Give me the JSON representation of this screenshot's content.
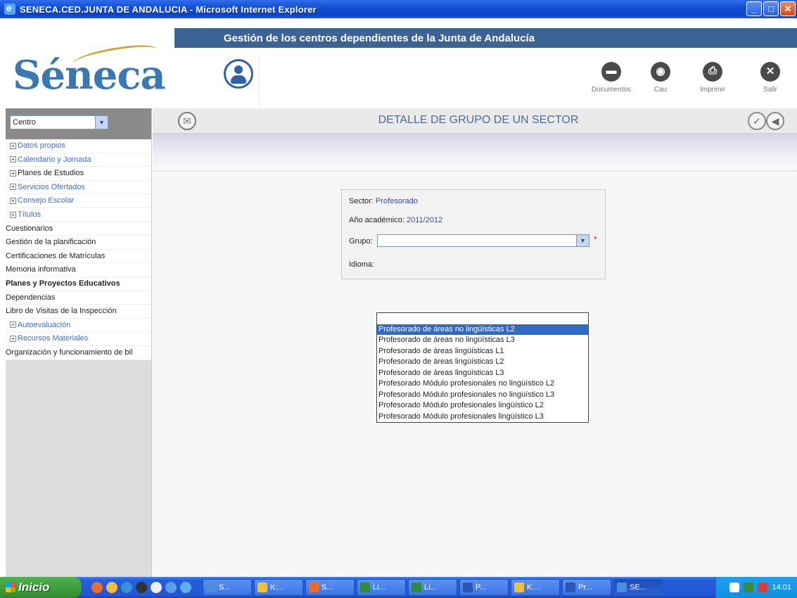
{
  "window": {
    "title": "SENECA.CED.JUNTA DE ANDALUCIA - Microsoft Internet Explorer",
    "minimize": "_",
    "maximize": "□",
    "close": "✕"
  },
  "header": {
    "banner": "Gestión de los centros dependientes de la Junta de Andalucía",
    "logo": "Séneca",
    "buttons": [
      {
        "label": "Documentos",
        "icon": "documents-icon",
        "glyph": "▬"
      },
      {
        "label": "Cau",
        "icon": "cau-icon",
        "glyph": "◉"
      },
      {
        "label": "Imprimir",
        "icon": "print-icon",
        "glyph": "⎙"
      },
      {
        "label": "Salir",
        "icon": "exit-icon",
        "glyph": "✕"
      }
    ]
  },
  "sidebar": {
    "centro_select": "Centro",
    "items": [
      {
        "label": "Datos propios",
        "expandable": true,
        "color": "blue"
      },
      {
        "label": "Calendario y Jornada",
        "expandable": true,
        "color": "blue"
      },
      {
        "label": "Planes de Estudios",
        "expandable": true,
        "color": "black"
      },
      {
        "label": "Servicios Ofertados",
        "expandable": true,
        "color": "blue"
      },
      {
        "label": "Consejo Escolar",
        "expandable": true,
        "color": "blue"
      },
      {
        "label": "Títulos",
        "expandable": true,
        "color": "blue"
      },
      {
        "label": "Cuestionarios",
        "expandable": false,
        "color": "black"
      },
      {
        "label": "Gestión de la planificación",
        "expandable": false,
        "color": "black"
      },
      {
        "label": "Certificaciones de Matrículas",
        "expandable": false,
        "color": "black"
      },
      {
        "label": "Memoria informativa",
        "expandable": false,
        "color": "black"
      },
      {
        "label": "Planes y Proyectos Educativos",
        "expandable": false,
        "color": "black",
        "bold": true
      },
      {
        "label": "Dependencias",
        "expandable": false,
        "color": "black"
      },
      {
        "label": "Libro de Visitas de la Inspección",
        "expandable": false,
        "color": "black"
      },
      {
        "label": "Autoevaluación",
        "expandable": true,
        "color": "blue"
      },
      {
        "label": "Recursos Materiales",
        "expandable": true,
        "color": "blue"
      },
      {
        "label": "Organización y funcionamiento de bil",
        "expandable": false,
        "color": "black"
      }
    ]
  },
  "main": {
    "title": "DETALLE DE GRUPO DE UN SECTOR",
    "form": {
      "sector_label": "Sector:",
      "sector_value": "Profesorado",
      "anio_label": "Año académico:",
      "anio_value": "2011/2012",
      "grupo_label": "Grupo:",
      "grupo_value": "",
      "required_mark": "*",
      "idioma_label": "Idioma:"
    },
    "dropdown_options": [
      "",
      "Profesorado de áreas no lingüísticas L2",
      "Profesorado de áreas no lingüísticas L3",
      "Profesorado de áreas lingüísticas L1",
      "Profesorado de áreas lingüísticas L2",
      "Profesorado de áreas lingüísticas L3",
      "Profesorado Módulo profesionales no lingüístico L2",
      "Profesorado Módulo profesionales no lingüístico L3",
      "Profesorado Módulo profesionales lingüístico L2",
      "Profesorado Módulo profesionales lingüístico L3"
    ],
    "dropdown_selected_index": 1
  },
  "taskbar": {
    "start": "Inicio",
    "tasks": [
      {
        "label": "S...",
        "color": "#4b8ee0"
      },
      {
        "label": "K:...",
        "color": "#f0c040"
      },
      {
        "label": "S...",
        "color": "#e86a2a"
      },
      {
        "label": "Li...",
        "color": "#2e8b3a"
      },
      {
        "label": "Li...",
        "color": "#2e8b3a"
      },
      {
        "label": "P...",
        "color": "#2a56b8"
      },
      {
        "label": "K:...",
        "color": "#f0c040"
      },
      {
        "label": "Pr...",
        "color": "#2a56b8"
      },
      {
        "label": "SE...",
        "color": "#4b8ee0",
        "active": true
      }
    ],
    "clock": "14:01"
  }
}
